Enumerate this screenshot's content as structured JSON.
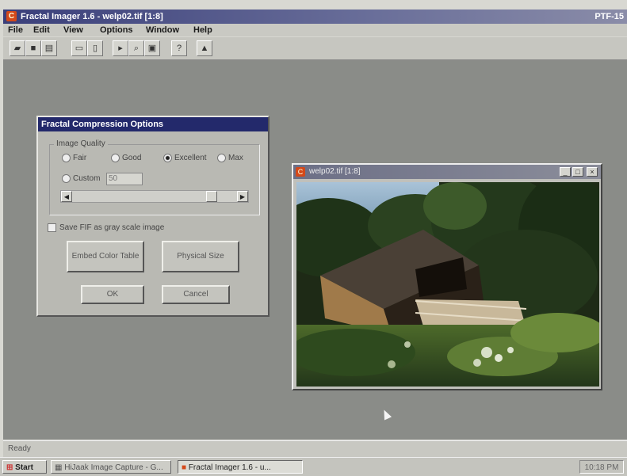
{
  "app": {
    "title": "Fractal Imager 1.6 - welp02.tif [1:8]",
    "title_right": "PTF-15"
  },
  "menu": [
    "File",
    "Edit",
    "View",
    "Options",
    "Window",
    "Help"
  ],
  "toolbar_icons": [
    "open-folder-icon",
    "save-icon",
    "print-icon",
    "copy-icon",
    "paste-icon",
    "select-icon",
    "zoom-icon",
    "fit-icon",
    "help-icon",
    "compress-icon"
  ],
  "dialog": {
    "title": "Fractal Compression Options",
    "group_label": "Image Quality",
    "options": [
      {
        "label": "Fair",
        "selected": false
      },
      {
        "label": "Good",
        "selected": false
      },
      {
        "label": "Excellent",
        "selected": true
      },
      {
        "label": "Max",
        "selected": false
      }
    ],
    "custom_label": "Custom",
    "custom_value": "50",
    "slider_level": 0.87,
    "gray_label": "Save FIF as gray scale image",
    "embed_button": "Embed Color Table",
    "physical_button": "Physical Size",
    "ok_button": "OK",
    "cancel_button": "Cancel"
  },
  "image_window": {
    "title": "welp02.tif [1:8]"
  },
  "status": {
    "text": "Ready"
  },
  "taskbar": {
    "start": "Start",
    "tasks": [
      "HiJaak Image Capture - G...",
      "Fractal Imager 1.6 - u..."
    ],
    "clock": "10:18 PM"
  },
  "colors": {
    "title_bar": "#3a3f7a",
    "dialog_title": "#23296b",
    "workspace": "#8a8c88"
  }
}
